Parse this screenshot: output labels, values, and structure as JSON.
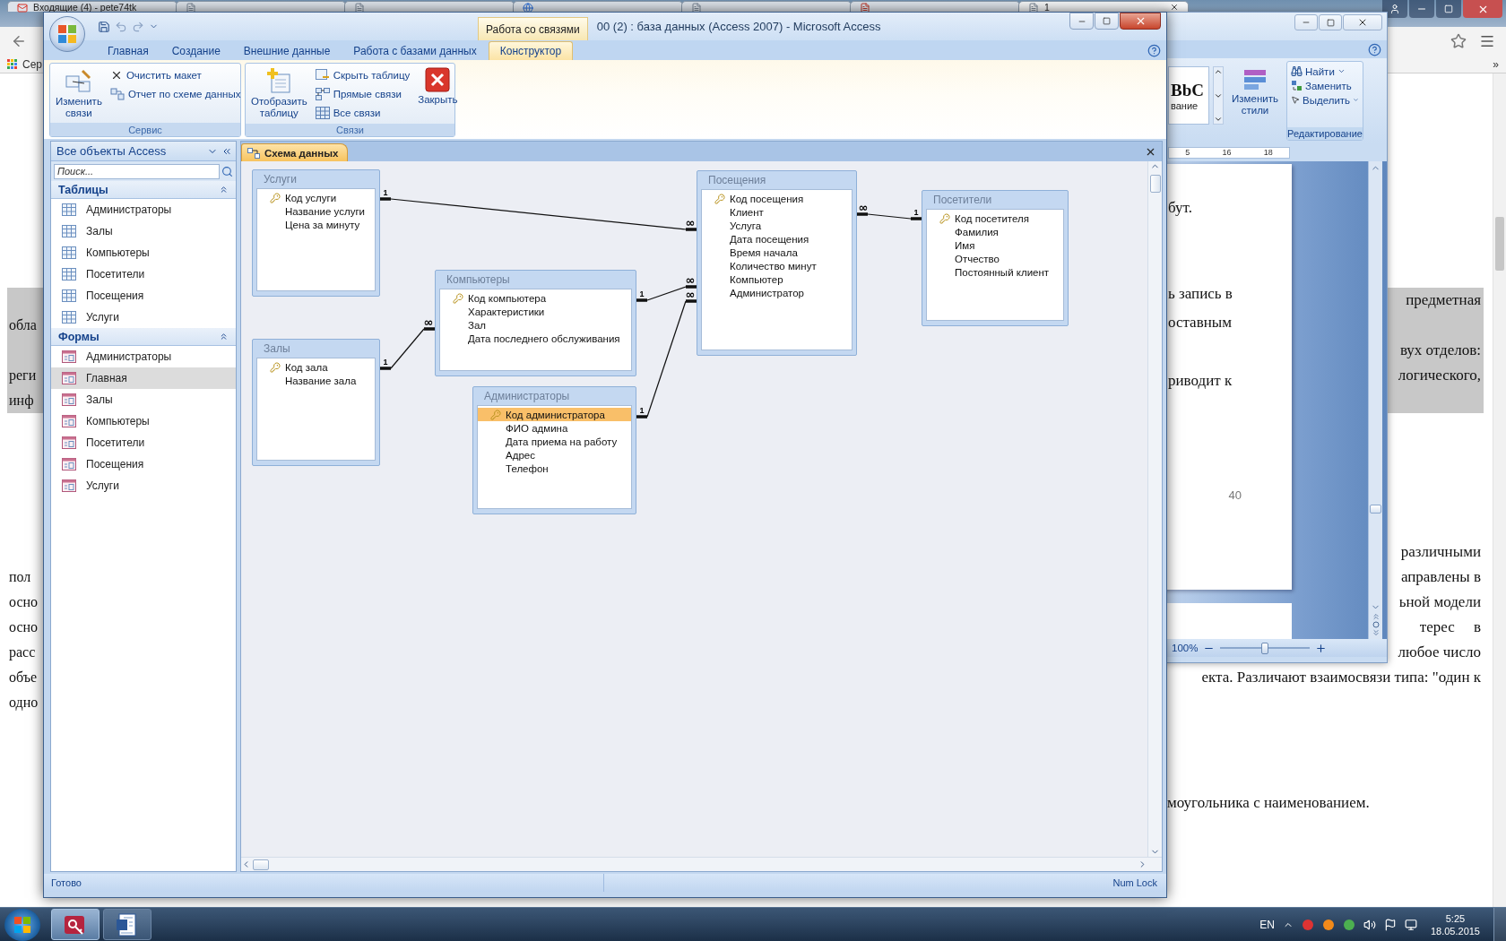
{
  "browser": {
    "tabs": [
      {
        "kind": "mail",
        "title": "Входящие (4) - pete74tk",
        "selected": false
      },
      {
        "kind": "page",
        "selected": false
      },
      {
        "kind": "page",
        "selected": false
      },
      {
        "kind": "site",
        "selected": false
      },
      {
        "kind": "page",
        "selected": false
      },
      {
        "kind": "pdf",
        "selected": false
      },
      {
        "kind": "page",
        "title": "1",
        "selected": true
      }
    ],
    "bookmarks": [
      {
        "label": "Сер"
      }
    ],
    "bookmarks_overflow": "»",
    "document": {
      "blocks": [
        {
          "highlighted": true,
          "lines": [
            {
              "kind": "justified",
              "right": "предметная"
            },
            {
              "left": "обла"
            },
            {
              "kind": "justified",
              "right": "вух отделов:"
            },
            {
              "kind": "justified",
              "left": "реги",
              "right": "логического,"
            },
            {
              "left": "инф"
            }
          ]
        },
        {
          "highlighted": false,
          "lines": [
            {
              "kind": "justified",
              "right": "различными"
            },
            {
              "kind": "justified",
              "left": "пол",
              "right": "аправлены в"
            },
            {
              "kind": "justified",
              "left": "осно",
              "right": "ьной модели"
            },
            {
              "kind": "justified",
              "left": "осно",
              "right": "терес     в"
            },
            {
              "kind": "justified",
              "left": "расс",
              "right": "любое число"
            },
            {
              "kind": "justified",
              "left": "объе",
              "right": "екта. Различают взаимосвязи типа: \"один к"
            },
            {
              "left": "одно"
            }
          ]
        },
        {
          "highlighted": false,
          "lines": [
            {
              "kind": "end",
              "right": "моугольника с наименованием."
            }
          ]
        }
      ]
    }
  },
  "word": {
    "gallery_preview": "BbC",
    "gallery_label": "вание",
    "change_styles": "Изменить стили",
    "editing": [
      {
        "kind": "find",
        "label": "Найти",
        "menu": true
      },
      {
        "kind": "replace",
        "label": "Заменить",
        "menu": false
      },
      {
        "kind": "select",
        "label": "Выделить",
        "menu": true
      }
    ],
    "editing_group": "Редактирование",
    "ruler": [
      "5",
      "16",
      "18"
    ],
    "page_paragraphs": [
      [
        "бут."
      ],
      [
        "ь запись в",
        "оставным"
      ],
      [
        "риводит к"
      ]
    ],
    "page_number": "40",
    "zoom_label": "100%",
    "zoom_slider": {
      "level": 0.5
    }
  },
  "access": {
    "title": "00 (2) : база данных (Access 2007) - Microsoft Access",
    "context_group": "Работа со связями",
    "tabs": [
      {
        "label": "Главная",
        "selected": false
      },
      {
        "label": "Создание",
        "selected": false
      },
      {
        "label": "Внешние данные",
        "selected": false
      },
      {
        "label": "Работа с базами данных",
        "selected": false
      },
      {
        "label": "Конструктор",
        "selected": true
      }
    ],
    "ribbon_groups": [
      {
        "label": "Сервис",
        "buttons": [
          {
            "kind": "large",
            "label": "Изменить связи"
          },
          {
            "kind": "small",
            "label": "Очистить макет"
          },
          {
            "kind": "small",
            "label": "Отчет по схеме данных"
          }
        ]
      },
      {
        "label": "Связи",
        "buttons": [
          {
            "kind": "large",
            "label": "Отобразить таблицу"
          },
          {
            "kind": "small",
            "label": "Скрыть таблицу"
          },
          {
            "kind": "small",
            "label": "Прямые связи"
          },
          {
            "kind": "small",
            "label": "Все связи"
          },
          {
            "kind": "large",
            "label": "Закрыть"
          }
        ]
      }
    ],
    "nav": {
      "title": "Все объекты Access",
      "search_placeholder": "Поиск...",
      "groups": [
        {
          "label": "Таблицы",
          "kind": "table",
          "expanded": true,
          "items": [
            {
              "label": "Администраторы",
              "selected": false
            },
            {
              "label": "Залы",
              "selected": false
            },
            {
              "label": "Компьютеры",
              "selected": false
            },
            {
              "label": "Посетители",
              "selected": false
            },
            {
              "label": "Посещения",
              "selected": false
            },
            {
              "label": "Услуги",
              "selected": false
            }
          ]
        },
        {
          "label": "Формы",
          "kind": "form",
          "expanded": true,
          "items": [
            {
              "label": "Администраторы",
              "selected": false
            },
            {
              "label": "Главная",
              "selected": true
            },
            {
              "label": "Залы",
              "selected": false
            },
            {
              "label": "Компьютеры",
              "selected": false
            },
            {
              "label": "Посетители",
              "selected": false
            },
            {
              "label": "Посещения",
              "selected": false
            },
            {
              "label": "Услуги",
              "selected": false
            }
          ]
        }
      ]
    },
    "document_tab": "Схема данных",
    "diagram": {
      "tables": [
        {
          "name": "Услуги",
          "fields": [
            {
              "name": "Код услуги",
              "key": true,
              "selected": false
            },
            {
              "name": "Название услуги",
              "key": false,
              "selected": false
            },
            {
              "name": "Цена за минуту",
              "key": false,
              "selected": false
            }
          ]
        },
        {
          "name": "Посещения",
          "fields": [
            {
              "name": "Код посещения",
              "key": true,
              "selected": false
            },
            {
              "name": "Клиент",
              "key": false,
              "selected": false
            },
            {
              "name": "Услуга",
              "key": false,
              "selected": false
            },
            {
              "name": "Дата посещения",
              "key": false,
              "selected": false
            },
            {
              "name": "Время начала",
              "key": false,
              "selected": false
            },
            {
              "name": "Количество минут",
              "key": false,
              "selected": false
            },
            {
              "name": "Компьютер",
              "key": false,
              "selected": false
            },
            {
              "name": "Администратор",
              "key": false,
              "selected": false
            }
          ]
        },
        {
          "name": "Посетители",
          "fields": [
            {
              "name": "Код посетителя",
              "key": true,
              "selected": false
            },
            {
              "name": "Фамилия",
              "key": false,
              "selected": false
            },
            {
              "name": "Имя",
              "key": false,
              "selected": false
            },
            {
              "name": "Отчество",
              "key": false,
              "selected": false
            },
            {
              "name": "Постоянный клиент",
              "key": false,
              "selected": false
            }
          ]
        },
        {
          "name": "Компьютеры",
          "fields": [
            {
              "name": "Код компьютера",
              "key": true,
              "selected": false
            },
            {
              "name": "Характеристики",
              "key": false,
              "selected": false
            },
            {
              "name": "Зал",
              "key": false,
              "selected": false
            },
            {
              "name": "Дата последнего обслуживания",
              "key": false,
              "selected": false
            }
          ]
        },
        {
          "name": "Залы",
          "fields": [
            {
              "name": "Код зала",
              "key": true,
              "selected": false
            },
            {
              "name": "Название зала",
              "key": false,
              "selected": false
            }
          ]
        },
        {
          "name": "Администраторы",
          "fields": [
            {
              "name": "Код администратора",
              "key": true,
              "selected": true
            },
            {
              "name": "ФИО админа",
              "key": false,
              "selected": false
            },
            {
              "name": "Дата приема на работу",
              "key": false,
              "selected": false
            },
            {
              "name": "Адрес",
              "key": false,
              "selected": false
            },
            {
              "name": "Телефон",
              "key": false,
              "selected": false
            }
          ]
        }
      ],
      "relationships": [
        {
          "one": "1",
          "many": "∞"
        },
        {
          "one": "1",
          "many": "∞"
        },
        {
          "one": "1",
          "many": "∞"
        },
        {
          "one": "1",
          "many": "∞"
        },
        {
          "one": "1",
          "many": "∞"
        }
      ]
    },
    "status": {
      "left": "Готово",
      "right": "Num Lock"
    }
  },
  "taskbar": {
    "apps": [
      {
        "kind": "access",
        "selected": true
      },
      {
        "kind": "word",
        "selected": false
      }
    ],
    "language": "EN",
    "time": "5:25",
    "date": "18.05.2015"
  }
}
